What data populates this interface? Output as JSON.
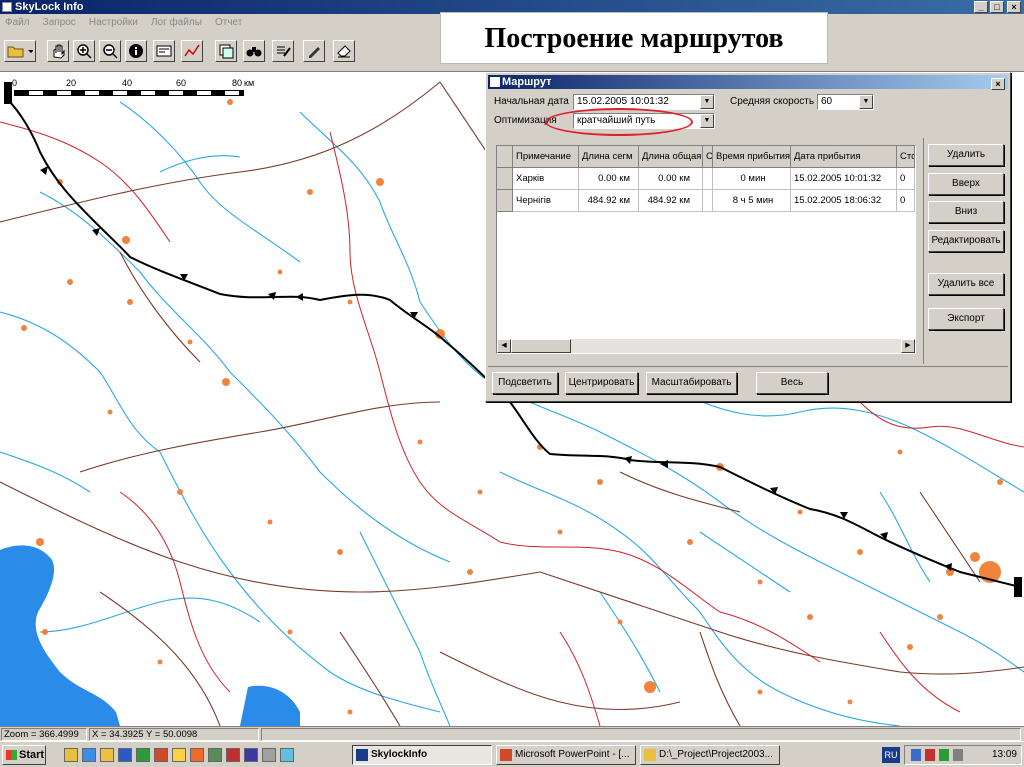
{
  "app": {
    "title": "SkyLock Info"
  },
  "menu": [
    "Файл",
    "Запрос",
    "Настройки",
    "Лог файлы",
    "Отчет"
  ],
  "slide_title": "Построение маршрутов",
  "scale": {
    "ticks": [
      "0",
      "20",
      "40",
      "60",
      "80"
    ],
    "unit": "км"
  },
  "dialog": {
    "title": "Маршрут",
    "start_date_label": "Начальная дата",
    "start_date_value": "15.02.2005 10:01:32",
    "avg_speed_label": "Средняя скорость",
    "avg_speed_value": "60",
    "optimization_label": "Оптимизация",
    "optimization_value": "кратчайший путь",
    "table": {
      "headers": [
        "Примечание",
        "Длина сегм",
        "Длина общая",
        "С",
        "Время прибытия",
        "Дата прибытия",
        "Сто"
      ],
      "rows": [
        [
          "Харків",
          "0.00 км",
          "0.00 км",
          "",
          "0 мин",
          "15.02.2005 10:01:32",
          "0"
        ],
        [
          "Чернігів",
          "484.92 км",
          "484.92 км",
          "",
          "8 ч 5 мин",
          "15.02.2005 18:06:32",
          "0"
        ]
      ]
    },
    "side_buttons": [
      "Удалить",
      "Вверх",
      "Вниз",
      "Редактировать",
      "Удалить все",
      "Экспорт"
    ],
    "bottom_buttons": [
      "Подсветить",
      "Центрировать",
      "Масштабировать",
      "Весь"
    ]
  },
  "status": {
    "zoom": "Zoom = 366.4999",
    "coords": "X = 34.3925 Y = 50.0098"
  },
  "taskbar": {
    "start": "Start",
    "tasks": [
      "SkylockInfo",
      "Microsoft PowerPoint - [...",
      "D:\\_Project\\Project2003..."
    ],
    "lang": "RU",
    "clock": "13:09"
  },
  "colors": {
    "river": "#29a8e0",
    "road": "#7a3a2a",
    "border": "#d0202a",
    "route": "#000000",
    "town": "#f0843c",
    "water": "#2a8ce8"
  }
}
